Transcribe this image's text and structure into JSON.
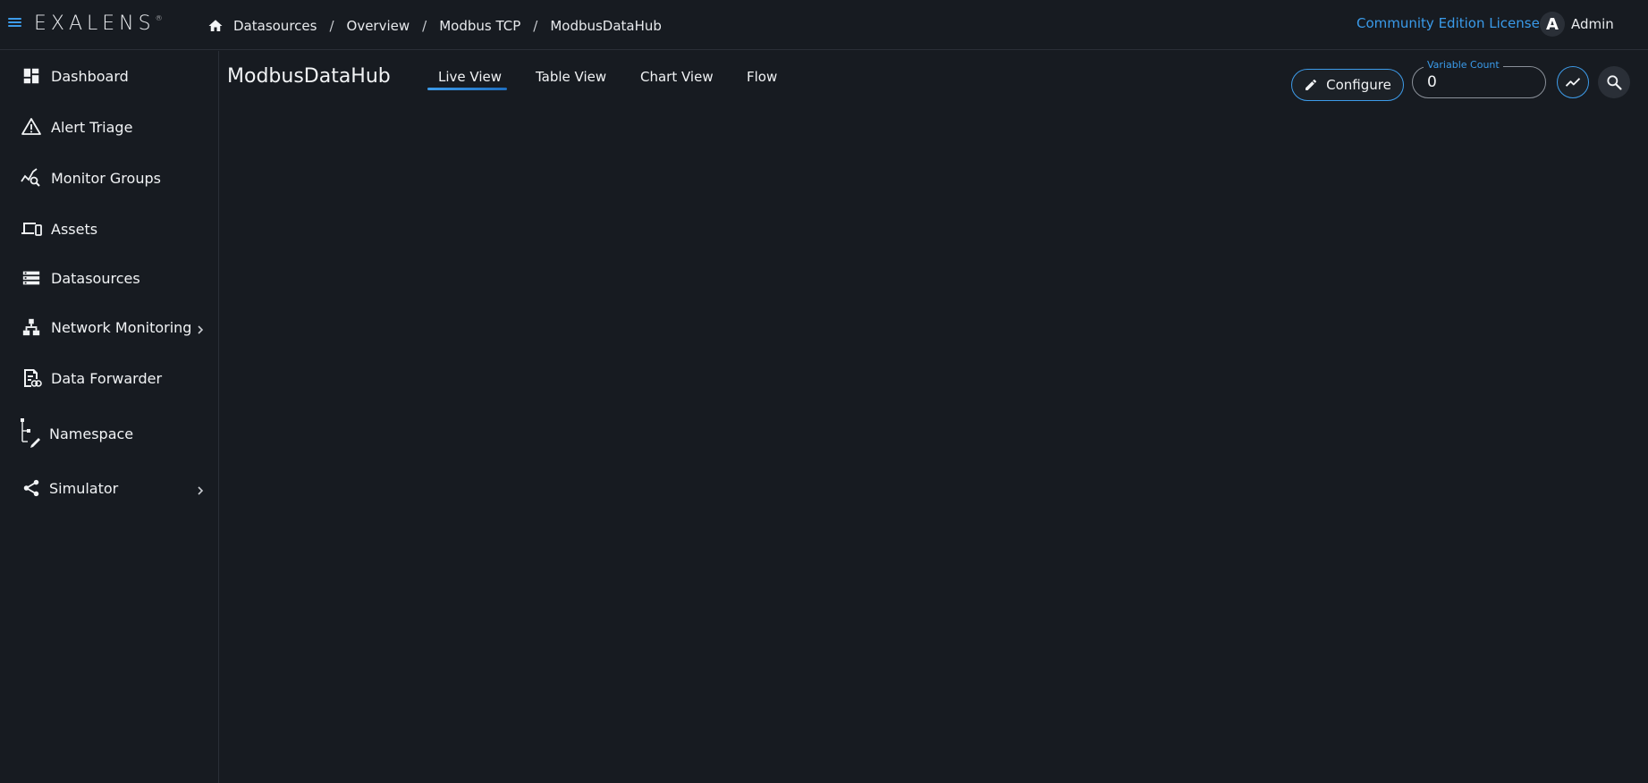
{
  "app": {
    "logo_text": "EXALENS",
    "logo_mark": "®"
  },
  "breadcrumb": [
    {
      "label": "Datasources"
    },
    {
      "label": "Overview"
    },
    {
      "label": "Modbus TCP"
    },
    {
      "label": "ModbusDataHub"
    }
  ],
  "breadcrumb_separator": "/",
  "header": {
    "license_link": "Community Edition License",
    "user_initial": "A",
    "user_name": "Admin"
  },
  "sidebar": {
    "items": [
      {
        "label": "Dashboard",
        "icon": "dashboard-icon"
      },
      {
        "label": "Alert Triage",
        "icon": "warning-icon"
      },
      {
        "label": "Monitor Groups",
        "icon": "monitor-search-icon"
      },
      {
        "label": "Assets",
        "icon": "devices-icon"
      },
      {
        "label": "Datasources",
        "icon": "storage-icon"
      },
      {
        "label": "Network Monitoring",
        "icon": "network-icon",
        "expandable": true
      },
      {
        "label": "Data Forwarder",
        "icon": "forwarder-icon"
      },
      {
        "label": "Namespace",
        "icon": "namespace-icon"
      },
      {
        "label": "Simulator",
        "icon": "share-icon",
        "expandable": true
      }
    ]
  },
  "main": {
    "title": "ModbusDataHub",
    "tabs": [
      {
        "label": "Live View",
        "active": true
      },
      {
        "label": "Table View",
        "active": false
      },
      {
        "label": "Chart View",
        "active": false
      },
      {
        "label": "Flow",
        "active": false
      }
    ],
    "configure_label": "Configure",
    "variable_count": {
      "label": "Variable Count",
      "value": "0"
    }
  },
  "colors": {
    "background": "#171b21",
    "accent": "#3d9be9",
    "border": "#2a2f37",
    "text": "#f1f3f5"
  }
}
